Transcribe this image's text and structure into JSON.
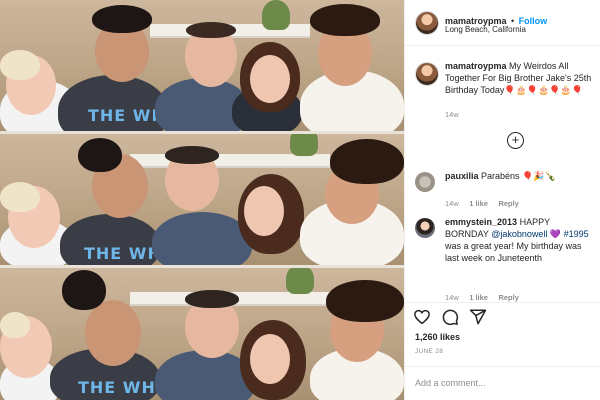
{
  "post": {
    "username": "mamatroypma",
    "follow_label": "Follow",
    "location": "Long Beach, California",
    "caption_user": "mamatroypma",
    "caption_text": "My Weirdos All Together For Big Brother Jake's 25th Birthday Today🎈🎂🎈🎂🎈🎂🎈",
    "caption_age": "14w",
    "load_more_icon": "plus-circle-icon",
    "likes": "1,260 likes",
    "date": "JUNE 28",
    "add_comment_placeholder": "Add a comment..."
  },
  "photo": {
    "shirt_text": "THE WHO",
    "colors": {
      "wall": "#c6ae92",
      "shelf": "#f2efe9",
      "strip_separator": "#e9e2d8"
    }
  },
  "comments": [
    {
      "user": "pauxilia",
      "text": "Parabéns 🎈🎉🍾",
      "age": "14w",
      "likes": "1 like",
      "reply": "Reply"
    },
    {
      "user": "emmystein_2013",
      "text_before": "HAPPY BORNDAY ",
      "mention": "@jakobnowell",
      "text_heart": " 💜",
      "hashtag": "#1995",
      "text_after": " was a great year! My birthday was last week on Juneteenth",
      "age": "14w",
      "likes": "1 like",
      "reply": "Reply"
    }
  ],
  "actions": {
    "like_icon": "heart-icon",
    "comment_icon": "comment-icon",
    "share_icon": "share-icon"
  },
  "colors": {
    "follow": "#0095f6",
    "link": "#00376b",
    "muted": "#8e8e8e",
    "text": "#262626"
  }
}
